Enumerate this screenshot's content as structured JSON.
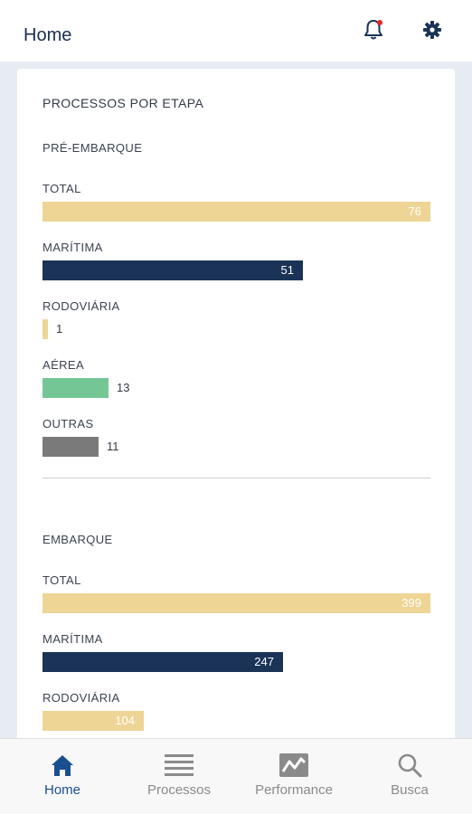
{
  "header": {
    "title": "Home",
    "notification_icon": "bell-icon",
    "settings_icon": "gear-icon"
  },
  "colors": {
    "navy": "#1a3357",
    "sand": "#eed596",
    "green": "#74c795",
    "gray": "#7a7a7a",
    "notification_dot": "#e5242b",
    "nav_active": "#1a4f8f",
    "nav_inactive": "#8a8a8a"
  },
  "card": {
    "title": "PROCESSOS POR ETAPA",
    "groups": [
      {
        "name": "PRÉ-EMBARQUE",
        "rows": [
          {
            "label": "TOTAL",
            "value": 76,
            "color": "sand"
          },
          {
            "label": "MARÍTIMA",
            "value": 51,
            "color": "navy"
          },
          {
            "label": "RODOVIÁRIA",
            "value": 1,
            "color": "sand"
          },
          {
            "label": "AÉREA",
            "value": 13,
            "color": "green"
          },
          {
            "label": "OUTRAS",
            "value": 11,
            "color": "gray"
          }
        ]
      },
      {
        "name": "EMBARQUE",
        "rows": [
          {
            "label": "TOTAL",
            "value": 399,
            "color": "sand"
          },
          {
            "label": "MARÍTIMA",
            "value": 247,
            "color": "navy"
          },
          {
            "label": "RODOVIÁRIA",
            "value": 104,
            "color": "sand"
          }
        ]
      }
    ]
  },
  "nav": {
    "items": [
      {
        "label": "Home",
        "icon": "home-icon",
        "active": true
      },
      {
        "label": "Processos",
        "icon": "list-icon",
        "active": false
      },
      {
        "label": "Performance",
        "icon": "chart-icon",
        "active": false
      },
      {
        "label": "Busca",
        "icon": "search-icon",
        "active": false
      }
    ]
  }
}
